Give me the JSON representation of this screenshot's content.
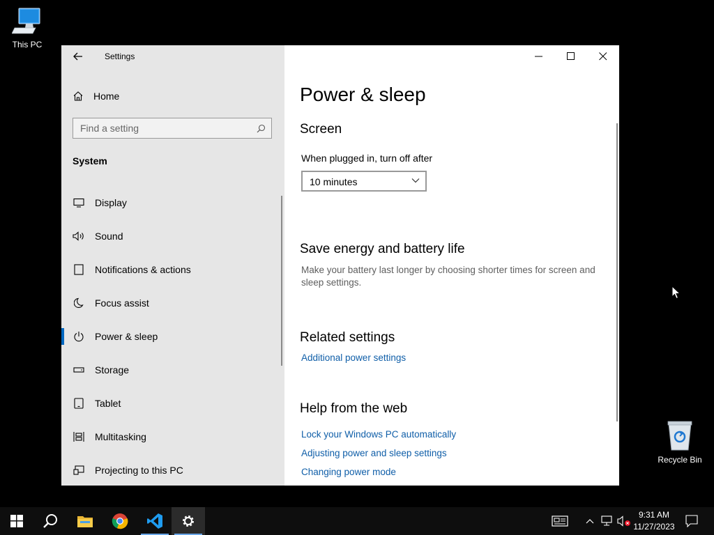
{
  "desktop": {
    "this_pc": "This PC",
    "recycle_bin": "Recycle Bin"
  },
  "window": {
    "app_title": "Settings",
    "sidebar": {
      "home": "Home",
      "search_placeholder": "Find a setting",
      "section": "System",
      "items": [
        {
          "label": "Display",
          "icon": "display-icon"
        },
        {
          "label": "Sound",
          "icon": "speaker-icon"
        },
        {
          "label": "Notifications & actions",
          "icon": "notification-icon"
        },
        {
          "label": "Focus assist",
          "icon": "moon-icon"
        },
        {
          "label": "Power & sleep",
          "icon": "power-icon",
          "active": true
        },
        {
          "label": "Storage",
          "icon": "storage-icon"
        },
        {
          "label": "Tablet",
          "icon": "tablet-icon"
        },
        {
          "label": "Multitasking",
          "icon": "multitasking-icon"
        },
        {
          "label": "Projecting to this PC",
          "icon": "projector-icon"
        }
      ]
    },
    "content": {
      "title": "Power & sleep",
      "screen": {
        "heading": "Screen",
        "plugged_label": "When plugged in, turn off after",
        "plugged_value": "10 minutes"
      },
      "save_energy": {
        "heading": "Save energy and battery life",
        "text": "Make your battery last longer by choosing shorter times for screen and sleep settings."
      },
      "related": {
        "heading": "Related settings",
        "link": "Additional power settings"
      },
      "help": {
        "heading": "Help from the web",
        "links": [
          "Lock your Windows PC automatically",
          "Adjusting power and sleep settings",
          "Changing power mode"
        ]
      }
    }
  },
  "taskbar": {
    "apps": [
      "start",
      "search",
      "file-explorer",
      "chrome",
      "vscode",
      "settings"
    ],
    "active_app": "settings",
    "time": "9:31 AM",
    "date": "11/27/2023"
  },
  "colors": {
    "accent": "#0067c0",
    "link": "#0f5ea8",
    "sidebar_bg": "#e6e6e6",
    "taskbar_bg": "#0e0e0e"
  }
}
